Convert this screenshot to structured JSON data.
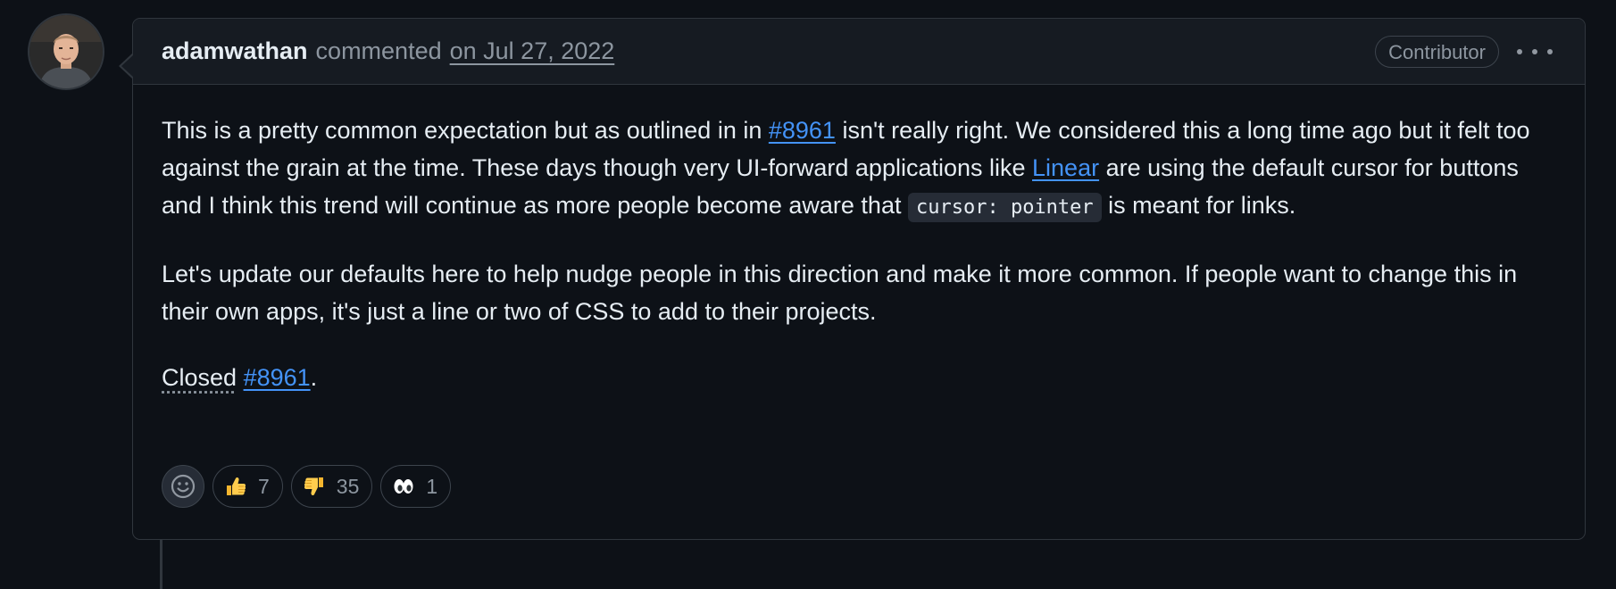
{
  "comment": {
    "author": "adamwathan",
    "action": "commented",
    "timestamp": "on Jul 27, 2022",
    "role_badge": "Contributor",
    "avatar_icon": "user-avatar",
    "menu_icon": "kebab-horizontal-icon",
    "paragraph1": {
      "t1": "This is a pretty common expectation but as outlined in in ",
      "link1": "#8961",
      "t2": " isn't really right. We considered this a long time ago but it felt too against the grain at the time. These days though very UI-forward applications like ",
      "link2": "Linear",
      "t3": " are using the default cursor for buttons and I think this trend will continue as more people become aware that ",
      "code": "cursor: pointer",
      "t4": " is meant for links."
    },
    "paragraph2": "Let's update our defaults here to help nudge people in this direction and make it more common. If people want to change this in their own apps, it's just a line or two of CSS to add to their projects.",
    "paragraph3": {
      "closed": "Closed",
      "link": "#8961",
      "period": "."
    }
  },
  "reactions": {
    "add_icon": "smiley-add-icon",
    "items": [
      {
        "icon": "thumbs-up-emoji",
        "count": "7"
      },
      {
        "icon": "thumbs-down-emoji",
        "count": "35"
      },
      {
        "icon": "eyes-emoji",
        "count": "1"
      }
    ]
  },
  "colors": {
    "background": "#0d1117",
    "header_bg": "#161b22",
    "border": "#30363d",
    "link": "#4493f8",
    "muted": "#8d96a0",
    "text": "#e6edf3"
  }
}
